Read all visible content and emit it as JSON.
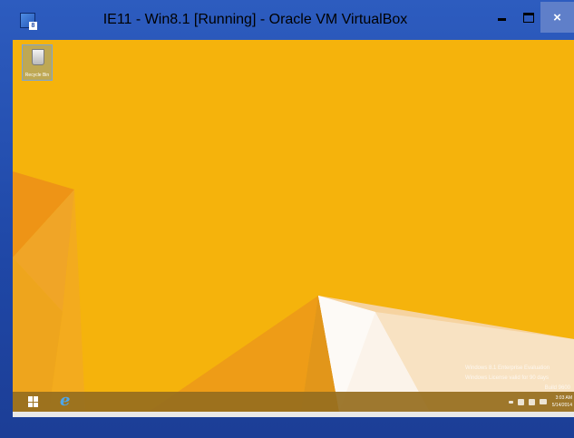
{
  "window": {
    "title": "IE11 - Win8.1 [Running] - Oracle VM VirtualBox",
    "app_icon": "virtualbox-icon",
    "app_icon_badge": "8",
    "buttons": {
      "minimize": "minimize-icon",
      "maximize": "maximize-icon",
      "close_glyph": "×"
    }
  },
  "desktop": {
    "wallpaper_colors": [
      "#f5b30c",
      "#ef9a14",
      "#f7d07a",
      "#fbf6f0"
    ],
    "icons": [
      {
        "label": "Recycle Bin",
        "icon": "recycle-bin-icon"
      }
    ],
    "watermark": {
      "line1": "Windows 8.1 Enterprise Evaluation",
      "line2": "Windows License valid for 90 days",
      "line3": "Build 9600"
    }
  },
  "taskbar": {
    "start_icon": "windows-start-icon",
    "pinned": [
      {
        "name": "Internet Explorer",
        "icon": "internet-explorer-icon",
        "glyph": "e"
      }
    ],
    "tray_icons": [
      "expand-tray-icon",
      "volume-icon",
      "network-icon",
      "flag-icon"
    ],
    "clock_time": "3:03 AM",
    "clock_date": "5/14/2014"
  }
}
